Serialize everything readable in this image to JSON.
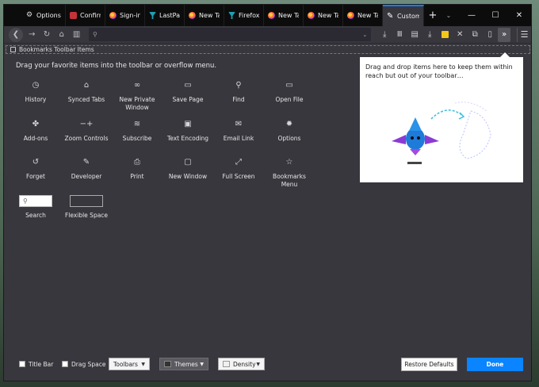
{
  "tabs": [
    {
      "label": "Options",
      "icon": "gear-icon",
      "fav": "gear"
    },
    {
      "label": "Confirm",
      "icon": "red-square-icon",
      "fav": "red"
    },
    {
      "label": "Sign-in",
      "icon": "firefox-icon",
      "fav": "ff"
    },
    {
      "label": "LastPass",
      "icon": "lastpass-icon",
      "fav": "teal"
    },
    {
      "label": "New Tab",
      "icon": "firefox-icon",
      "fav": "ff"
    },
    {
      "label": "Firefox",
      "icon": "firefox-dev-icon",
      "fav": "teal"
    },
    {
      "label": "New Tab",
      "icon": "firefox-icon",
      "fav": "ff"
    },
    {
      "label": "New Tab",
      "icon": "firefox-icon",
      "fav": "ff"
    },
    {
      "label": "New Tab",
      "icon": "firefox-icon",
      "fav": "ff"
    },
    {
      "label": "Customize",
      "icon": "brush-icon",
      "fav": "brush",
      "active": true
    }
  ],
  "bookmarks_toolbar": {
    "label": "Bookmarks Toolbar Items"
  },
  "instructions": "Drag your favorite items into the toolbar or overflow menu.",
  "palette": [
    {
      "label": "History",
      "icon": "clock-icon",
      "glyph": "◷"
    },
    {
      "label": "Synced Tabs",
      "icon": "laptop-icon",
      "glyph": "⌂"
    },
    {
      "label": "New Private\nWindow",
      "icon": "mask-icon",
      "glyph": "∞"
    },
    {
      "label": "Save Page",
      "icon": "folder-icon",
      "glyph": "▭"
    },
    {
      "label": "Find",
      "icon": "magnifier-icon",
      "glyph": "⚲"
    },
    {
      "label": "Open File",
      "icon": "open-folder-icon",
      "glyph": "▭"
    },
    {
      "label": "Add-ons",
      "icon": "puzzle-icon",
      "glyph": "✤"
    },
    {
      "label": "Zoom Controls",
      "icon": "zoom-icon",
      "glyph": "−+"
    },
    {
      "label": "Subscribe",
      "icon": "rss-icon",
      "glyph": "≋"
    },
    {
      "label": "Text Encoding",
      "icon": "encoding-icon",
      "glyph": "▣"
    },
    {
      "label": "Email Link",
      "icon": "mail-icon",
      "glyph": "✉"
    },
    {
      "label": "Options",
      "icon": "gear-icon",
      "glyph": "✹"
    },
    {
      "label": "Forget",
      "icon": "forget-icon",
      "glyph": "↺"
    },
    {
      "label": "Developer",
      "icon": "wrench-icon",
      "glyph": "✎"
    },
    {
      "label": "Print",
      "icon": "printer-icon",
      "glyph": "⎙"
    },
    {
      "label": "New Window",
      "icon": "window-icon",
      "glyph": "▢"
    },
    {
      "label": "Full Screen",
      "icon": "fullscreen-icon",
      "glyph": "⤢"
    },
    {
      "label": "Bookmarks\nMenu",
      "icon": "bookmarks-menu-icon",
      "glyph": "☆"
    },
    {
      "label": "Search",
      "icon": "search-box",
      "glyph": "⚲",
      "special": "search"
    },
    {
      "label": "Flexible Space",
      "icon": "flexible-space",
      "glyph": "",
      "special": "flex"
    }
  ],
  "overflow_panel": {
    "text": "Drag and drop items here to keep them within reach but out of your toolbar…"
  },
  "bottom": {
    "title_bar": "Title Bar",
    "drag_space": "Drag Space",
    "toolbars": "Toolbars",
    "themes": "Themes",
    "density": "Density",
    "restore": "Restore Defaults",
    "done": "Done"
  }
}
